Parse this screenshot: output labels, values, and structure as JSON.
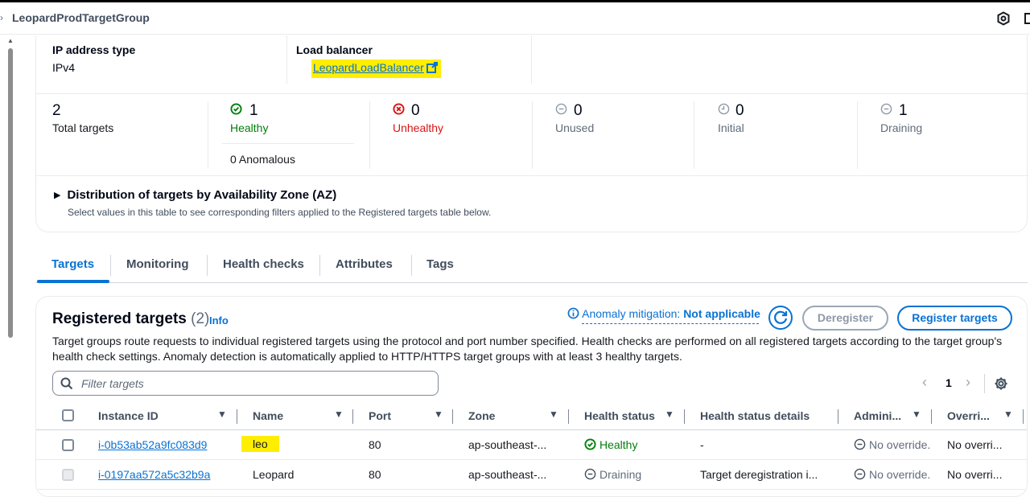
{
  "titlebar": {
    "title": "LeopardProdTargetGroup"
  },
  "details": {
    "ip_type_label": "IP address type",
    "ip_type_value": "IPv4",
    "lb_label": "Load balancer",
    "lb_value": "LeopardLoadBalancer"
  },
  "stats": {
    "total": {
      "num": "2",
      "label": "Total targets"
    },
    "healthy": {
      "num": "1",
      "label": "Healthy",
      "anomalous": "0 Anomalous"
    },
    "unhealthy": {
      "num": "0",
      "label": "Unhealthy"
    },
    "unused": {
      "num": "0",
      "label": "Unused"
    },
    "initial": {
      "num": "0",
      "label": "Initial"
    },
    "draining": {
      "num": "1",
      "label": "Draining"
    }
  },
  "az": {
    "title": "Distribution of targets by Availability Zone (AZ)",
    "desc": "Select values in this table to see corresponding filters applied to the Registered targets table below."
  },
  "tabs": [
    "Targets",
    "Monitoring",
    "Health checks",
    "Attributes",
    "Tags"
  ],
  "registered": {
    "title": "Registered targets",
    "count": "(2)",
    "info": "Info",
    "anomaly_label": "Anomaly mitigation:",
    "anomaly_value": "Not applicable",
    "deregister": "Deregister",
    "register": "Register targets",
    "desc": "Target groups route requests to individual registered targets using the protocol and port number specified. Health checks are performed on all registered targets according to the target group's health check settings. Anomaly detection is automatically applied to HTTP/HTTPS target groups with at least 3 healthy targets.",
    "filter_placeholder": "Filter targets",
    "page": "1"
  },
  "table": {
    "columns": [
      "Instance ID",
      "Name",
      "Port",
      "Zone",
      "Health status",
      "Health status details",
      "Admini...",
      "Overri..."
    ],
    "rows": [
      {
        "instance": "i-0b53ab52a9fc083d9",
        "name": "leo",
        "port": "80",
        "zone": "ap-southeast-...",
        "health": "Healthy",
        "details": "-",
        "admin": "No override.",
        "override": "No overri..."
      },
      {
        "instance": "i-0197aa572a5c32b9a",
        "name": "Leopard",
        "port": "80",
        "zone": "ap-southeast-...",
        "health": "Draining",
        "details": "Target deregistration i...",
        "admin": "No override.",
        "override": "No overri..."
      }
    ]
  },
  "colors": {
    "link": "#0972d3",
    "healthy": "#037f0c",
    "unhealthy": "#d91515",
    "highlight": "#ffee00",
    "muted": "#5f6b7a"
  }
}
